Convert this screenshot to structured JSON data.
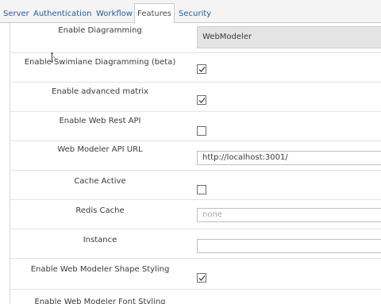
{
  "tabs": [
    {
      "label": "Server",
      "active": false
    },
    {
      "label": "Authentication",
      "active": false
    },
    {
      "label": "Workflow",
      "active": false
    },
    {
      "label": "Features",
      "active": true
    },
    {
      "label": "Security",
      "active": false
    }
  ],
  "settings": [
    {
      "label": "Enable Diagramming",
      "type": "select",
      "value": "WebModeler"
    },
    {
      "label": "Enable Swimlane Diagramming (beta)",
      "type": "checkbox",
      "checked": true
    },
    {
      "label": "Enable advanced matrix",
      "type": "checkbox",
      "checked": true
    },
    {
      "label": "Enable Web Rest API",
      "type": "checkbox",
      "checked": false
    },
    {
      "label": "Web Modeler API URL",
      "type": "text",
      "value": "http://localhost:3001/"
    },
    {
      "label": "Cache Active",
      "type": "checkbox",
      "checked": false
    },
    {
      "label": "Redis Cache",
      "type": "text",
      "placeholder": "none"
    },
    {
      "label": "Instance",
      "type": "text",
      "value": ""
    },
    {
      "label": "Enable Web Modeler Shape Styling",
      "type": "checkbox",
      "checked": true
    },
    {
      "label": "Enable Web Modeler Font Styling",
      "type": "checkbox",
      "checked": false
    }
  ]
}
